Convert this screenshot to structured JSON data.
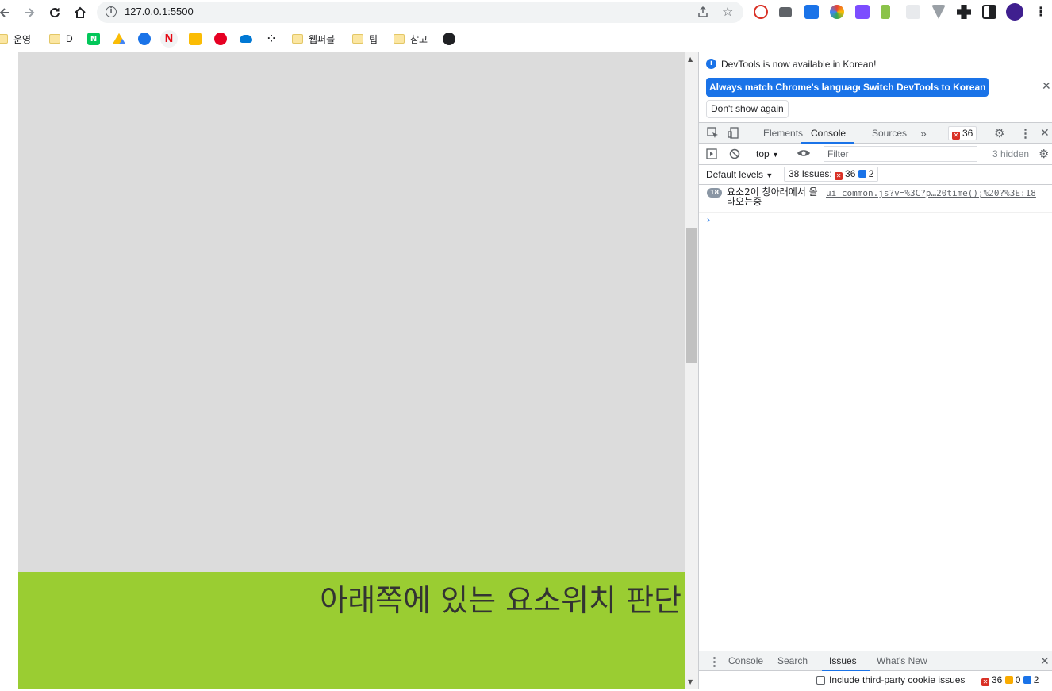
{
  "browser": {
    "url": "127.0.0.1:5500",
    "bookmarks": [
      {
        "label": "운영",
        "type": "folder"
      },
      {
        "label": "D",
        "type": "folder"
      },
      {
        "label": "N",
        "type": "site",
        "color": "#03c75a"
      },
      {
        "label": "",
        "type": "site",
        "color": "#34a853"
      },
      {
        "label": "",
        "type": "site",
        "color": "#1a73e8"
      },
      {
        "label": "N",
        "type": "site",
        "color": "#e50914"
      },
      {
        "label": "",
        "type": "site",
        "color": "#fbbc04"
      },
      {
        "label": "",
        "type": "site",
        "color": "#e60023"
      },
      {
        "label": "",
        "type": "site",
        "color": "#0078d4"
      },
      {
        "label": "",
        "type": "site",
        "color": "#202124"
      },
      {
        "label": "웹퍼블",
        "type": "folder"
      },
      {
        "label": "팁",
        "type": "folder"
      },
      {
        "label": "참고",
        "type": "folder"
      },
      {
        "label": "",
        "type": "site",
        "color": "#202124"
      }
    ]
  },
  "page": {
    "green_text": "아래쪽에 있는 요소위치 판단",
    "colors": {
      "gray": "#dcdcdc",
      "green": "#9acd32"
    }
  },
  "devtools": {
    "infobar": {
      "message": "DevTools is now available in Korean!",
      "btn_match": "Always match Chrome's language",
      "btn_switch": "Switch DevTools to Korean",
      "btn_dont": "Don't show again"
    },
    "tabs": {
      "elements": "Elements",
      "console": "Console",
      "sources": "Sources",
      "error_count": "36"
    },
    "toolbar": {
      "context": "top",
      "filter_placeholder": "Filter",
      "hidden": "3 hidden",
      "levels": "Default levels",
      "issues_label": "38 Issues:",
      "issues_err": "36",
      "issues_info": "2"
    },
    "log": {
      "count": "18",
      "message": "요소2이 창아래에서 올라오는중",
      "source": "ui_common.js?v=%3C?p…20time();%20?%3E:18"
    },
    "drawer": {
      "tabs": [
        "Console",
        "Search",
        "Issues",
        "What's New"
      ],
      "include_label": "Include third-party cookie issues",
      "err": "36",
      "warn": "0",
      "info": "2"
    }
  }
}
